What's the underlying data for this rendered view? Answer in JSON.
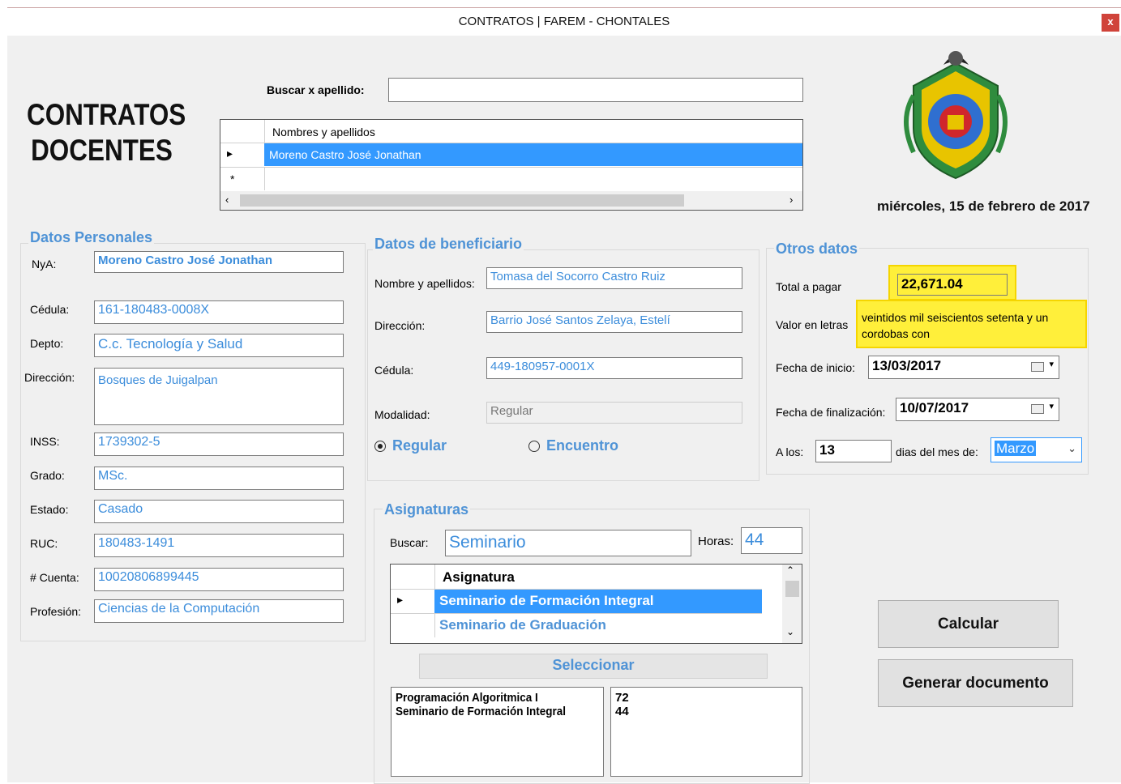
{
  "window": {
    "title": "CONTRATOS | FAREM - CHONTALES",
    "close_label": "x"
  },
  "header": {
    "title_line1": "CONTRATOS",
    "title_line2": "DOCENTES",
    "date": "miércoles, 15 de febrero de 2017"
  },
  "search": {
    "label": "Buscar x apellido:",
    "value": "",
    "grid_header": "Nombres y apellidos",
    "rows": [
      "Moreno Castro José Jonathan",
      ""
    ],
    "row_marker": "▸",
    "new_row_marker": "*"
  },
  "personal": {
    "group_title": "Datos Personales",
    "fields": {
      "nya": {
        "label": "NyA:",
        "value": "Moreno Castro José Jonathan"
      },
      "cedula": {
        "label": "Cédula:",
        "value": "161-180483-0008X"
      },
      "depto": {
        "label": "Depto:",
        "value": "C.c. Tecnología y Salud"
      },
      "direccion": {
        "label": "Dirección:",
        "value": "Bosques de Juigalpan"
      },
      "inss": {
        "label": "INSS:",
        "value": "1739302-5"
      },
      "grado": {
        "label": "Grado:",
        "value": "MSc."
      },
      "estado": {
        "label": "Estado:",
        "value": "Casado"
      },
      "ruc": {
        "label": "RUC:",
        "value": "180483-1491"
      },
      "cuenta": {
        "label": "# Cuenta:",
        "value": "10020806899445"
      },
      "profesion": {
        "label": "Profesión:",
        "value": "Ciencias de la Computación"
      }
    }
  },
  "beneficiary": {
    "group_title": "Datos de beneficiario",
    "fields": {
      "nombre": {
        "label": "Nombre y apellidos:",
        "value": "Tomasa del Socorro Castro Ruiz"
      },
      "direccion": {
        "label": "Dirección:",
        "value": "Barrio José Santos Zelaya, Estelí"
      },
      "cedula": {
        "label": "Cédula:",
        "value": "449-180957-0001X"
      },
      "modalidad": {
        "label": "Modalidad:",
        "value": "Regular"
      }
    },
    "radio_regular": "Regular",
    "radio_encuentro": "Encuentro",
    "selected_modality": "Regular"
  },
  "otros": {
    "group_title": "Otros datos",
    "total_label": "Total a pagar",
    "total_value": "22,671.04",
    "letras_label": "Valor en letras",
    "letras_value": "veintidos mil seiscientos setenta y un cordobas con",
    "inicio_label": "Fecha de inicio:",
    "inicio_value": "13/03/2017",
    "fin_label": "Fecha de finalización:",
    "fin_value": "10/07/2017",
    "alos_label": "A los:",
    "alos_value": "13",
    "mes_label": "dias del mes de:",
    "mes_value": "Marzo"
  },
  "asignaturas": {
    "group_title": "Asignaturas",
    "buscar_label": "Buscar:",
    "buscar_value": "Seminario",
    "horas_label": "Horas:",
    "horas_value": "44",
    "grid_header": "Asignatura",
    "rows": [
      "Seminario de Formación Integral",
      "Seminario de Graduación"
    ],
    "select_button": "Seleccionar",
    "selected_subjects": [
      "Programación Algoritmica I",
      "Seminario de Formación Integral"
    ],
    "selected_hours": [
      "72",
      "44"
    ]
  },
  "actions": {
    "calcular": "Calcular",
    "generar": "Generar documento"
  },
  "colors": {
    "accent_blue": "#4f93d6",
    "selection": "#3399ff",
    "highlight": "#ffef3a"
  }
}
